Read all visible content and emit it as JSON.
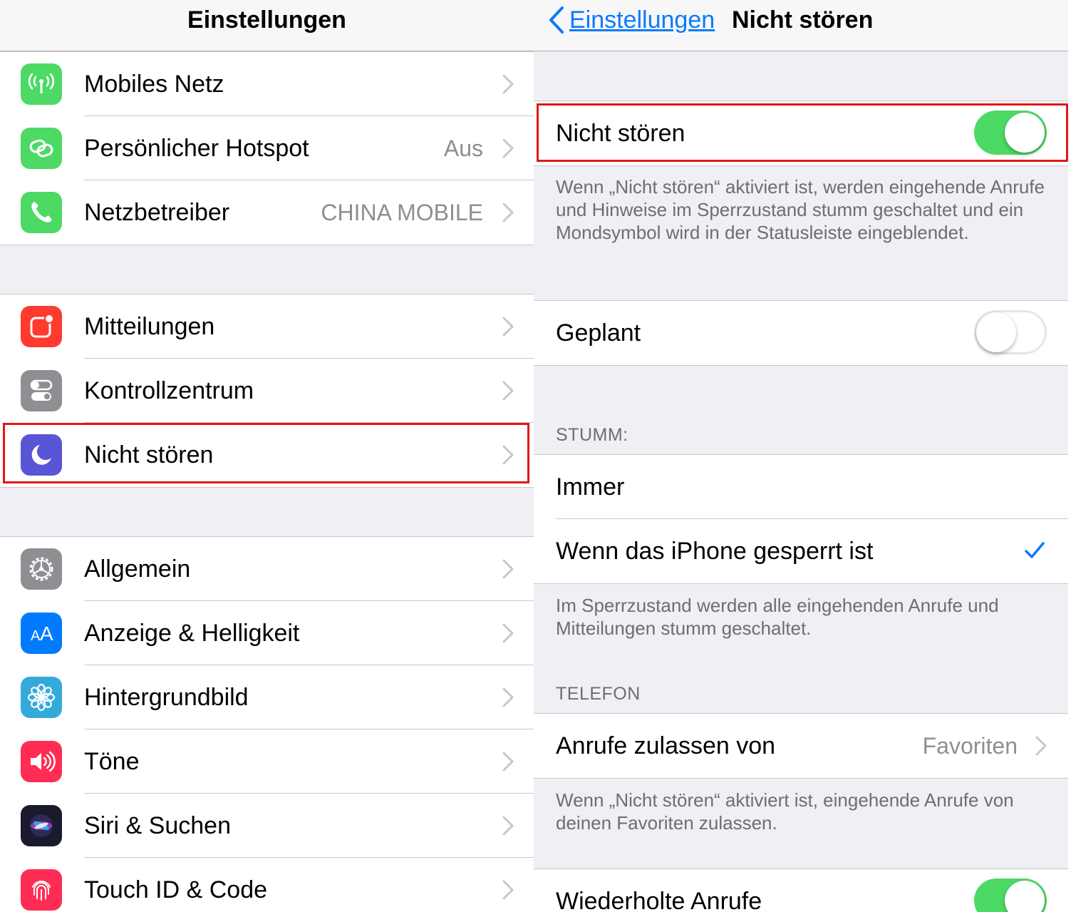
{
  "left_screen": {
    "title": "Einstellungen",
    "groups": [
      [
        {
          "label": "Mobiles Netz",
          "value": "",
          "icon": "antenna-icon",
          "icon_color": "#4cd964"
        },
        {
          "label": "Persönlicher Hotspot",
          "value": "Aus",
          "icon": "hotspot-link-icon",
          "icon_color": "#4cd964"
        },
        {
          "label": "Netzbetreiber",
          "value": "CHINA MOBILE",
          "icon": "phone-icon",
          "icon_color": "#4cd964"
        }
      ],
      [
        {
          "label": "Mitteilungen",
          "value": "",
          "icon": "notifications-icon",
          "icon_color": "#ff3b30"
        },
        {
          "label": "Kontrollzentrum",
          "value": "",
          "icon": "switches-icon",
          "icon_color": "#8e8e93"
        },
        {
          "label": "Nicht stören",
          "value": "",
          "icon": "moon-icon",
          "icon_color": "#5856d6"
        }
      ],
      [
        {
          "label": "Allgemein",
          "value": "",
          "icon": "gear-icon",
          "icon_color": "#8e8e93"
        },
        {
          "label": "Anzeige & Helligkeit",
          "value": "",
          "icon": "text-size-icon",
          "icon_color": "#007aff"
        },
        {
          "label": "Hintergrundbild",
          "value": "",
          "icon": "flower-icon",
          "icon_color": "#34aadc"
        },
        {
          "label": "Töne",
          "value": "",
          "icon": "speaker-icon",
          "icon_color": "#ff2d55"
        },
        {
          "label": "Siri & Suchen",
          "value": "",
          "icon": "siri-icon",
          "icon_color": "#1a1a2e"
        },
        {
          "label": "Touch ID & Code",
          "value": "",
          "icon": "fingerprint-icon",
          "icon_color": "#ff2d55"
        }
      ]
    ]
  },
  "right_screen": {
    "back_label": "Einstellungen",
    "title": "Nicht stören",
    "dnd": {
      "label": "Nicht stören",
      "on": true
    },
    "dnd_note": "Wenn „Nicht stören“ aktiviert ist, werden eingehende Anrufe und Hinweise im Sperrzustand stumm geschaltet und ein Mondsymbol wird in der Statusleiste eingeblendet.",
    "scheduled": {
      "label": "Geplant",
      "on": false
    },
    "silence_header": "STUMM:",
    "silence_options": [
      {
        "label": "Immer",
        "selected": false
      },
      {
        "label": "Wenn das iPhone gesperrt ist",
        "selected": true
      }
    ],
    "silence_note": "Im Sperrzustand werden alle eingehenden Anrufe und Mitteilungen stumm geschaltet.",
    "phone_header": "TELEFON",
    "allow_calls": {
      "label": "Anrufe zulassen von",
      "value": "Favoriten"
    },
    "allow_note": "Wenn „Nicht stören“ aktiviert ist, eingehende Anrufe von deinen Favoriten zulassen.",
    "repeated": {
      "label": "Wiederholte Anrufe",
      "on": true
    }
  },
  "colors": {
    "accent": "#0a7aff",
    "switch_on": "#4cd964",
    "highlight": "#e01818",
    "group_background": "#efeff4"
  }
}
